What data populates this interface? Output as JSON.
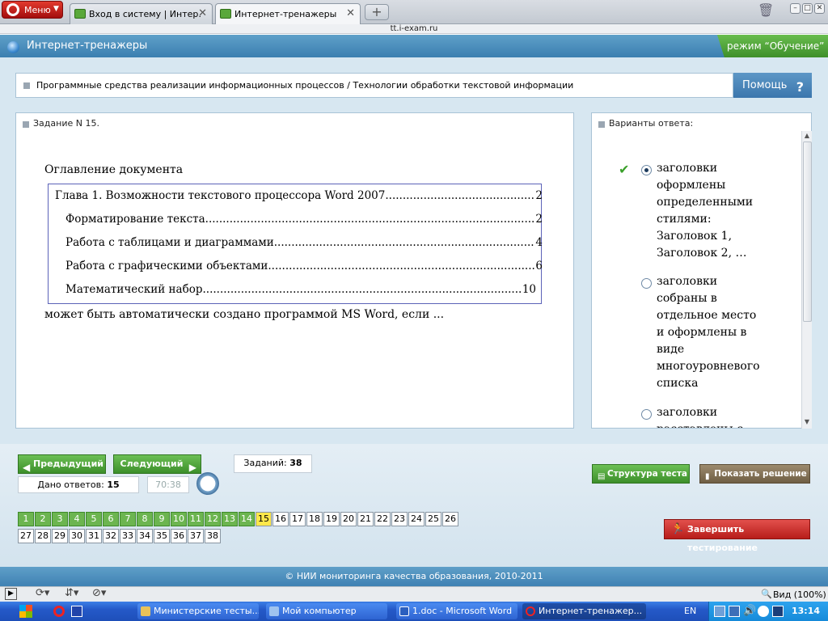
{
  "browser": {
    "menu_label": "Меню",
    "tabs": [
      {
        "label": "Вход в систему | Интер…"
      },
      {
        "label": "Интернет-тренажеры"
      }
    ],
    "url": "tt.i-exam.ru"
  },
  "site": {
    "title": "Интернет-тренажеры",
    "mode": "режим “Обучение”"
  },
  "breadcrumb": "Программные средства реализации информационных процессов / Технологии обработки текстовой информации",
  "help_label": "Помощь",
  "task": {
    "header": "Задание N 15.",
    "question_title": "Оглавление документа",
    "toc": [
      {
        "title": "Глава 1. Возможности текстового процессора Word 2007",
        "page": "2"
      },
      {
        "title": "Форматирование текста",
        "page": "2"
      },
      {
        "title": "Работа с таблицами и диаграммами",
        "page": "4"
      },
      {
        "title": "Работа с графическими объектами",
        "page": "6"
      },
      {
        "title": "Математический набор",
        "page": "10"
      }
    ],
    "question_text": "может быть автоматически создано программой MS Word, если ..."
  },
  "answers": {
    "header": "Варианты ответа:",
    "options": [
      {
        "lines": [
          "заголовки",
          "оформлены",
          "определенными",
          "стилями:",
          "Заголовок 1,",
          "Заголовок 2, …"
        ],
        "selected": true
      },
      {
        "lines": [
          "заголовки",
          "собраны в",
          "отдельное место",
          "и оформлены в",
          "виде",
          "многоуровневого",
          "списка"
        ],
        "selected": false
      },
      {
        "lines": [
          "заголовки",
          "расставлены с"
        ],
        "selected": false
      }
    ]
  },
  "controls": {
    "prev": "Предыдущий",
    "next": "Следующий",
    "tasks_label": "Заданий:",
    "tasks_count": "38",
    "answered_label": "Дано ответов:",
    "answered_count": "15",
    "timer": "70:38",
    "structure": "Структура теста",
    "solution": "Показать решение",
    "finish": "Завершить тестирование",
    "current": 15,
    "answered_upto": 14,
    "total": 38
  },
  "copyright": "© НИИ мониторинга качества образования, 2010-2011",
  "statusbar": {
    "zoom": "Вид (100%)"
  },
  "taskbar": {
    "items": [
      "Министерские тесты...",
      "Мой компьютер",
      "1.doc - Microsoft Word",
      "Интернет-тренажер..."
    ],
    "lang": "EN",
    "time": "13:14"
  },
  "colors": {
    "green": "#3c8f2a",
    "blue": "#3b7fb0",
    "current": "#ffe84a"
  }
}
